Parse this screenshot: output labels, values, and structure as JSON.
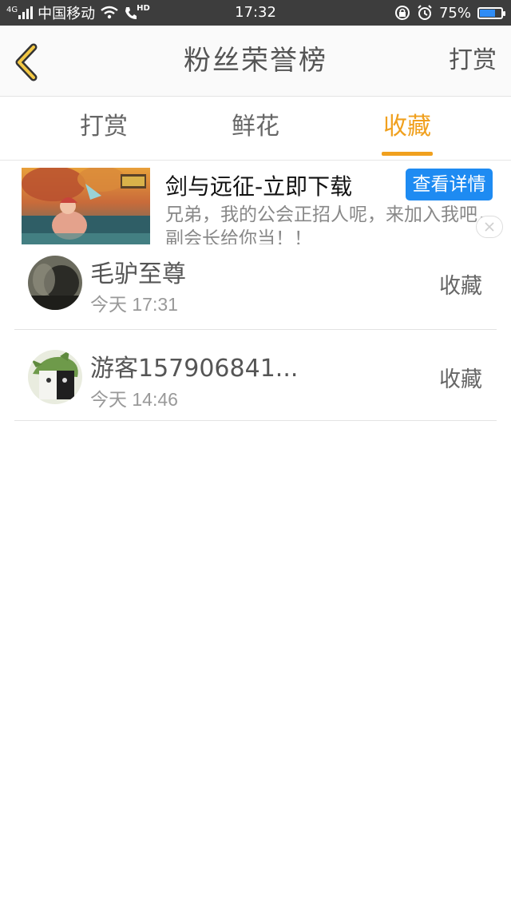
{
  "status_bar": {
    "network": "4G",
    "carrier": "中国移动",
    "hd": "HD",
    "time": "17:32",
    "battery": "75%",
    "battery_level": 0.75,
    "battery_color": "#2f8cf5"
  },
  "header": {
    "back_icon": "chevron-left-icon",
    "title": "粉丝荣誉榜",
    "right_action": "打赏"
  },
  "tabs": [
    {
      "label": "打赏",
      "active": false
    },
    {
      "label": "鲜花",
      "active": false
    },
    {
      "label": "收藏",
      "active": true
    }
  ],
  "accent_color": "#f0a01e",
  "ad": {
    "title": "剑与远征-立即下载",
    "cta": "查看详情",
    "description": "兄弟，我的公会正招人呢，来加入我吧，副会长给你当！！",
    "cta_color": "#1e8bf2",
    "close_icon": "close-icon"
  },
  "list": [
    {
      "name": "毛驴至尊",
      "time": "今天 17:31",
      "action": "收藏"
    },
    {
      "name": "游客157906841...",
      "time": "今天 14:46",
      "action": "收藏"
    }
  ]
}
